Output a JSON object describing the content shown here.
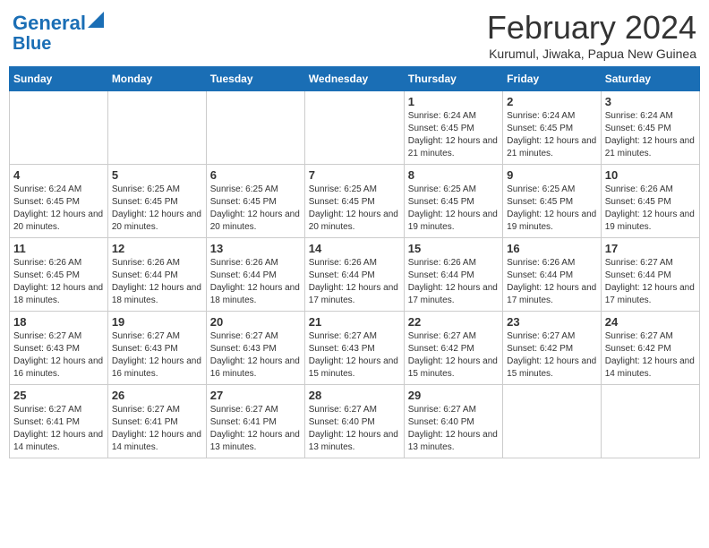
{
  "header": {
    "logo_line1": "General",
    "logo_line2": "Blue",
    "month_year": "February 2024",
    "location": "Kurumul, Jiwaka, Papua New Guinea"
  },
  "days_of_week": [
    "Sunday",
    "Monday",
    "Tuesday",
    "Wednesday",
    "Thursday",
    "Friday",
    "Saturday"
  ],
  "weeks": [
    [
      {
        "day": "",
        "sunrise": "",
        "sunset": "",
        "daylight": ""
      },
      {
        "day": "",
        "sunrise": "",
        "sunset": "",
        "daylight": ""
      },
      {
        "day": "",
        "sunrise": "",
        "sunset": "",
        "daylight": ""
      },
      {
        "day": "",
        "sunrise": "",
        "sunset": "",
        "daylight": ""
      },
      {
        "day": "1",
        "sunrise": "Sunrise: 6:24 AM",
        "sunset": "Sunset: 6:45 PM",
        "daylight": "Daylight: 12 hours and 21 minutes."
      },
      {
        "day": "2",
        "sunrise": "Sunrise: 6:24 AM",
        "sunset": "Sunset: 6:45 PM",
        "daylight": "Daylight: 12 hours and 21 minutes."
      },
      {
        "day": "3",
        "sunrise": "Sunrise: 6:24 AM",
        "sunset": "Sunset: 6:45 PM",
        "daylight": "Daylight: 12 hours and 21 minutes."
      }
    ],
    [
      {
        "day": "4",
        "sunrise": "Sunrise: 6:24 AM",
        "sunset": "Sunset: 6:45 PM",
        "daylight": "Daylight: 12 hours and 20 minutes."
      },
      {
        "day": "5",
        "sunrise": "Sunrise: 6:25 AM",
        "sunset": "Sunset: 6:45 PM",
        "daylight": "Daylight: 12 hours and 20 minutes."
      },
      {
        "day": "6",
        "sunrise": "Sunrise: 6:25 AM",
        "sunset": "Sunset: 6:45 PM",
        "daylight": "Daylight: 12 hours and 20 minutes."
      },
      {
        "day": "7",
        "sunrise": "Sunrise: 6:25 AM",
        "sunset": "Sunset: 6:45 PM",
        "daylight": "Daylight: 12 hours and 20 minutes."
      },
      {
        "day": "8",
        "sunrise": "Sunrise: 6:25 AM",
        "sunset": "Sunset: 6:45 PM",
        "daylight": "Daylight: 12 hours and 19 minutes."
      },
      {
        "day": "9",
        "sunrise": "Sunrise: 6:25 AM",
        "sunset": "Sunset: 6:45 PM",
        "daylight": "Daylight: 12 hours and 19 minutes."
      },
      {
        "day": "10",
        "sunrise": "Sunrise: 6:26 AM",
        "sunset": "Sunset: 6:45 PM",
        "daylight": "Daylight: 12 hours and 19 minutes."
      }
    ],
    [
      {
        "day": "11",
        "sunrise": "Sunrise: 6:26 AM",
        "sunset": "Sunset: 6:45 PM",
        "daylight": "Daylight: 12 hours and 18 minutes."
      },
      {
        "day": "12",
        "sunrise": "Sunrise: 6:26 AM",
        "sunset": "Sunset: 6:44 PM",
        "daylight": "Daylight: 12 hours and 18 minutes."
      },
      {
        "day": "13",
        "sunrise": "Sunrise: 6:26 AM",
        "sunset": "Sunset: 6:44 PM",
        "daylight": "Daylight: 12 hours and 18 minutes."
      },
      {
        "day": "14",
        "sunrise": "Sunrise: 6:26 AM",
        "sunset": "Sunset: 6:44 PM",
        "daylight": "Daylight: 12 hours and 17 minutes."
      },
      {
        "day": "15",
        "sunrise": "Sunrise: 6:26 AM",
        "sunset": "Sunset: 6:44 PM",
        "daylight": "Daylight: 12 hours and 17 minutes."
      },
      {
        "day": "16",
        "sunrise": "Sunrise: 6:26 AM",
        "sunset": "Sunset: 6:44 PM",
        "daylight": "Daylight: 12 hours and 17 minutes."
      },
      {
        "day": "17",
        "sunrise": "Sunrise: 6:27 AM",
        "sunset": "Sunset: 6:44 PM",
        "daylight": "Daylight: 12 hours and 17 minutes."
      }
    ],
    [
      {
        "day": "18",
        "sunrise": "Sunrise: 6:27 AM",
        "sunset": "Sunset: 6:43 PM",
        "daylight": "Daylight: 12 hours and 16 minutes."
      },
      {
        "day": "19",
        "sunrise": "Sunrise: 6:27 AM",
        "sunset": "Sunset: 6:43 PM",
        "daylight": "Daylight: 12 hours and 16 minutes."
      },
      {
        "day": "20",
        "sunrise": "Sunrise: 6:27 AM",
        "sunset": "Sunset: 6:43 PM",
        "daylight": "Daylight: 12 hours and 16 minutes."
      },
      {
        "day": "21",
        "sunrise": "Sunrise: 6:27 AM",
        "sunset": "Sunset: 6:43 PM",
        "daylight": "Daylight: 12 hours and 15 minutes."
      },
      {
        "day": "22",
        "sunrise": "Sunrise: 6:27 AM",
        "sunset": "Sunset: 6:42 PM",
        "daylight": "Daylight: 12 hours and 15 minutes."
      },
      {
        "day": "23",
        "sunrise": "Sunrise: 6:27 AM",
        "sunset": "Sunset: 6:42 PM",
        "daylight": "Daylight: 12 hours and 15 minutes."
      },
      {
        "day": "24",
        "sunrise": "Sunrise: 6:27 AM",
        "sunset": "Sunset: 6:42 PM",
        "daylight": "Daylight: 12 hours and 14 minutes."
      }
    ],
    [
      {
        "day": "25",
        "sunrise": "Sunrise: 6:27 AM",
        "sunset": "Sunset: 6:41 PM",
        "daylight": "Daylight: 12 hours and 14 minutes."
      },
      {
        "day": "26",
        "sunrise": "Sunrise: 6:27 AM",
        "sunset": "Sunset: 6:41 PM",
        "daylight": "Daylight: 12 hours and 14 minutes."
      },
      {
        "day": "27",
        "sunrise": "Sunrise: 6:27 AM",
        "sunset": "Sunset: 6:41 PM",
        "daylight": "Daylight: 12 hours and 13 minutes."
      },
      {
        "day": "28",
        "sunrise": "Sunrise: 6:27 AM",
        "sunset": "Sunset: 6:40 PM",
        "daylight": "Daylight: 12 hours and 13 minutes."
      },
      {
        "day": "29",
        "sunrise": "Sunrise: 6:27 AM",
        "sunset": "Sunset: 6:40 PM",
        "daylight": "Daylight: 12 hours and 13 minutes."
      },
      {
        "day": "",
        "sunrise": "",
        "sunset": "",
        "daylight": ""
      },
      {
        "day": "",
        "sunrise": "",
        "sunset": "",
        "daylight": ""
      }
    ]
  ]
}
